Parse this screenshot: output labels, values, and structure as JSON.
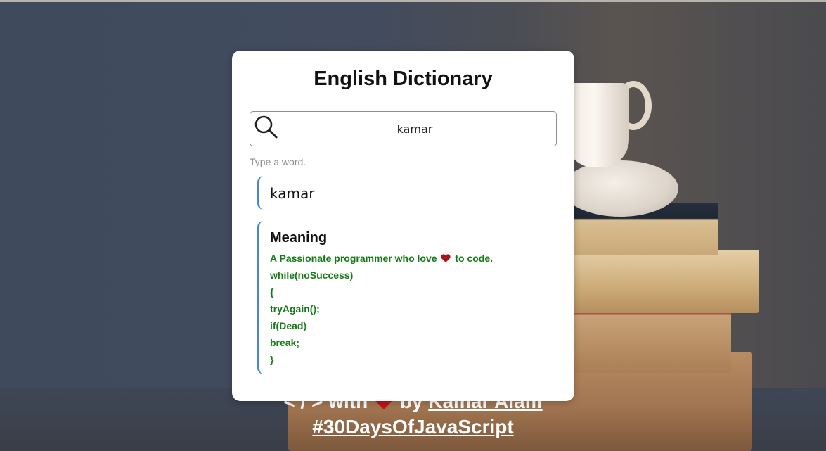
{
  "app": {
    "title": "English Dictionary"
  },
  "search": {
    "value": "kamar",
    "icon": "search-icon",
    "hint": "Type a word."
  },
  "result": {
    "word": "kamar",
    "meaning_heading": "Meaning",
    "meaning_lines": [
      {
        "before": "A Passionate programmer who love",
        "after": "to code.",
        "icon": "heart-icon"
      },
      {
        "text": "while(noSuccess)"
      },
      {
        "text": "{"
      },
      {
        "text": "tryAgain();"
      },
      {
        "text": "if(Dead)"
      },
      {
        "text": "break;"
      },
      {
        "text": "}"
      }
    ]
  },
  "footer": {
    "code_symbol": "< / > with",
    "by_text": "by",
    "author_link": "Kamar Alam",
    "hashtag_link": "#30DaysOfJavaScript",
    "icon": "heart-icon"
  },
  "colors": {
    "accent_border": "#4a86d8",
    "meaning_text": "#167a16",
    "heart": "#c0141c"
  }
}
